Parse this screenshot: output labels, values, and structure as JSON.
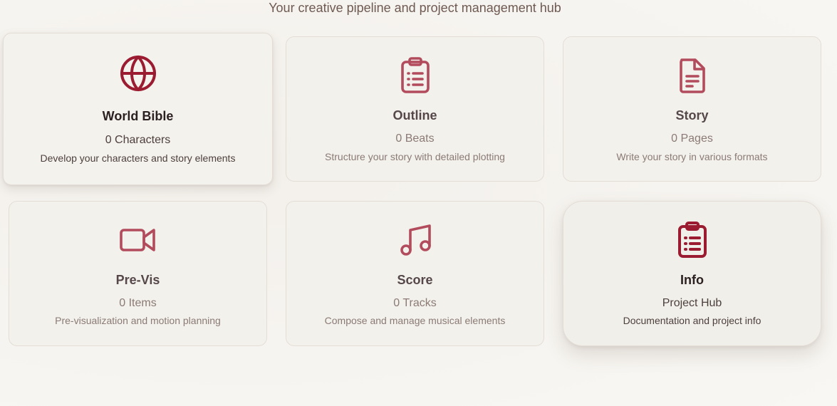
{
  "header": {
    "subtitle": "Your creative pipeline and project management hub"
  },
  "colors": {
    "accent": "#9b1b30",
    "accent_muted": "#b24c5d"
  },
  "cards": [
    {
      "title": "World Bible",
      "count": "0 Characters",
      "description": "Develop your characters and story elements",
      "icon": "globe-icon"
    },
    {
      "title": "Outline",
      "count": "0 Beats",
      "description": "Structure your story with detailed plotting",
      "icon": "clipboard-list-icon"
    },
    {
      "title": "Story",
      "count": "0 Pages",
      "description": "Write your story in various formats",
      "icon": "document-icon"
    },
    {
      "title": "Pre-Vis",
      "count": "0 Items",
      "description": "Pre-visualization and motion planning",
      "icon": "video-camera-icon"
    },
    {
      "title": "Score",
      "count": "0 Tracks",
      "description": "Compose and manage musical elements",
      "icon": "music-note-icon"
    },
    {
      "title": "Info",
      "count": "Project Hub",
      "description": "Documentation and project info",
      "icon": "clipboard-list-icon"
    }
  ]
}
